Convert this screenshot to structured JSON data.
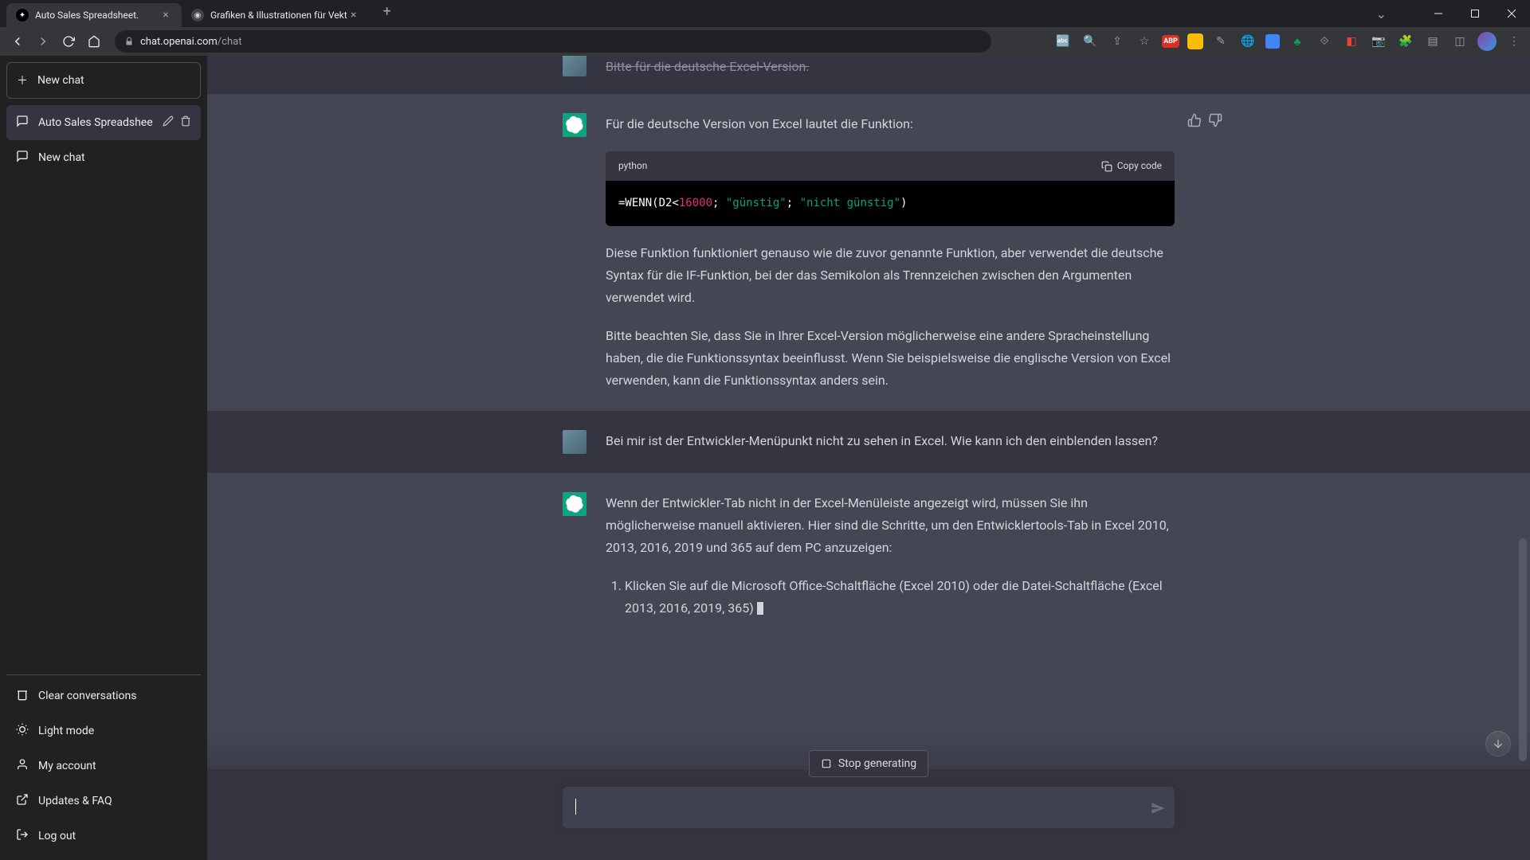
{
  "browser": {
    "tabs": [
      {
        "title": "Auto Sales Spreadsheet.",
        "favicon": "openai"
      },
      {
        "title": "Grafiken & Illustrationen für Vekt",
        "favicon": "generic"
      }
    ],
    "url_domain": "chat.openai.com",
    "url_path": "/chat"
  },
  "sidebar": {
    "new_chat_label": "New chat",
    "conversations": [
      {
        "label": "Auto Sales Spreadshee",
        "active": true
      },
      {
        "label": "New chat",
        "active": false
      }
    ],
    "footer": {
      "clear": "Clear conversations",
      "light_mode": "Light mode",
      "account": "My account",
      "updates": "Updates & FAQ",
      "logout": "Log out"
    }
  },
  "messages": {
    "user1_partial": "Bitte für die deutsche Excel-Version.",
    "assistant1": {
      "intro": "Für die deutsche Version von Excel lautet die Funktion:",
      "code_lang": "python",
      "copy_label": "Copy code",
      "code_prefix": "=WENN(D2<",
      "code_num": "16000",
      "code_mid": "; ",
      "code_str1": "\"günstig\"",
      "code_sep": "; ",
      "code_str2": "\"nicht günstig\"",
      "code_suffix": ")",
      "p1": "Diese Funktion funktioniert genauso wie die zuvor genannte Funktion, aber verwendet die deutsche Syntax für die IF-Funktion, bei der das Semikolon als Trennzeichen zwischen den Argumenten verwendet wird.",
      "p2": "Bitte beachten Sie, dass Sie in Ihrer Excel-Version möglicherweise eine andere Spracheinstellung haben, die die Funktionssyntax beeinflusst. Wenn Sie beispielsweise die englische Version von Excel verwenden, kann die Funktionssyntax anders sein."
    },
    "user2": "Bei mir ist der Entwickler-Menüpunkt nicht zu sehen in Excel. Wie kann ich den einblenden lassen?",
    "assistant2": {
      "intro": "Wenn der Entwickler-Tab nicht in der Excel-Menüleiste angezeigt wird, müssen Sie ihn möglicherweise manuell aktivieren. Hier sind die Schritte, um den Entwicklertools-Tab in Excel 2010, 2013, 2016, 2019 und 365 auf dem PC anzuzeigen:",
      "li1": "Klicken Sie auf die Microsoft Office-Schaltfläche (Excel 2010) oder die Datei-Schaltfläche (Excel 2013, 2016, 2019, 365)"
    }
  },
  "controls": {
    "stop_generating": "Stop generating"
  }
}
